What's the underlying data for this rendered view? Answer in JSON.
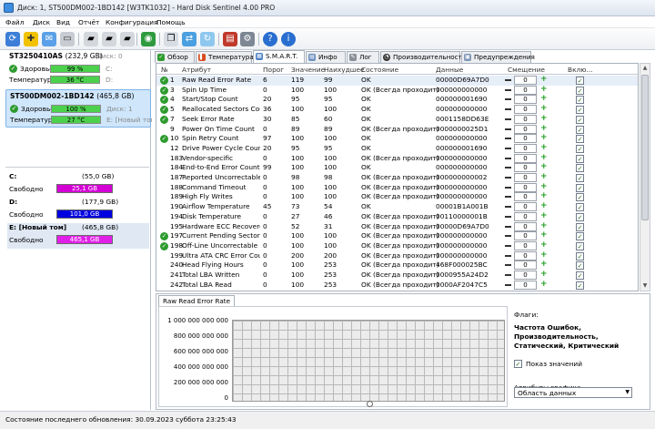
{
  "window": {
    "title": "Диск: 1, ST500DM002-1BD142 [W3TK1032]  -  Hard Disk Sentinel 4.00 PRO"
  },
  "menu": [
    "Файл",
    "Диск",
    "Вид",
    "Отчёт",
    "Конфигурация",
    "Помощь"
  ],
  "toolbar": [
    "refresh-icon",
    "health-icon",
    "mail-icon",
    "disk-icon",
    "drive-a-icon",
    "drive-b-icon",
    "drive-c-icon",
    "globe-icon",
    "copy-icon",
    "transfer-icon",
    "refresh-b-icon",
    "chart-icon",
    "settings-icon",
    "help-icon",
    "info-icon"
  ],
  "disks": [
    {
      "name": "ST3250410AS",
      "size": "(232,9 GB)",
      "disk": "Диск: 0",
      "health_label": "Здоровье:",
      "health": "99 %",
      "health_ext": "C:",
      "temp_label": "Температура:",
      "temp": "36 °C",
      "temp_ext": "D:"
    },
    {
      "name": "ST500DM002-1BD142",
      "size": "(465,8 GB)",
      "disk": "Диск: 1",
      "health_label": "Здоровье:",
      "health": "100 %",
      "health_ext": "Диск: 1",
      "temp_label": "Температура:",
      "temp": "27 °C",
      "temp_ext": "E: [Новый том]"
    }
  ],
  "volumes": [
    {
      "label": "C:",
      "size": "(55,0 GB)",
      "free_label": "Свободно",
      "free": "25,1 GB",
      "color": "#d400d4"
    },
    {
      "label": "D:",
      "size": "(177,9 GB)",
      "free_label": "Свободно",
      "free": "101,0 GB",
      "color": "#0000e0"
    },
    {
      "label": "E: [Новый том]",
      "size": "(465,8 GB)",
      "free_label": "Свободно",
      "free": "465,1 GB",
      "color": "#e020e8"
    }
  ],
  "tabs": [
    "Обзор",
    "Температура",
    "S.M.A.R.T.",
    "Инфо",
    "Лог",
    "Производительность",
    "Предупреждения"
  ],
  "columns": [
    "№",
    "Атрибут",
    "Порог",
    "Значение",
    "Наихудшее",
    "Состояние",
    "Данные",
    "Смещение",
    "Вклю..."
  ],
  "rows": [
    {
      "n": "1",
      "attr": "Raw Read Error Rate",
      "thr": "6",
      "val": "119",
      "worst": "99",
      "state": "OK",
      "data": "00000D69A7D0",
      "off": "0",
      "ok": true
    },
    {
      "n": "3",
      "attr": "Spin Up Time",
      "thr": "0",
      "val": "100",
      "worst": "100",
      "state": "OK (Всегда проходит)",
      "data": "000000000000",
      "off": "0",
      "ok": true
    },
    {
      "n": "4",
      "attr": "Start/Stop Count",
      "thr": "20",
      "val": "95",
      "worst": "95",
      "state": "OK",
      "data": "000000001690",
      "off": "0",
      "ok": true
    },
    {
      "n": "5",
      "attr": "Reallocated Sectors Count",
      "thr": "36",
      "val": "100",
      "worst": "100",
      "state": "OK",
      "data": "000000000000",
      "off": "0",
      "ok": true
    },
    {
      "n": "7",
      "attr": "Seek Error Rate",
      "thr": "30",
      "val": "85",
      "worst": "60",
      "state": "OK",
      "data": "0001158DD63E",
      "off": "0",
      "ok": true
    },
    {
      "n": "9",
      "attr": "Power On Time Count",
      "thr": "0",
      "val": "89",
      "worst": "89",
      "state": "OK (Всегда проходит)",
      "data": "0000000025D1",
      "off": "0",
      "ok": false
    },
    {
      "n": "10",
      "attr": "Spin Retry Count",
      "thr": "97",
      "val": "100",
      "worst": "100",
      "state": "OK",
      "data": "000000000000",
      "off": "0",
      "ok": true
    },
    {
      "n": "12",
      "attr": "Drive Power Cycle Count",
      "thr": "20",
      "val": "95",
      "worst": "95",
      "state": "OK",
      "data": "000000001690",
      "off": "0",
      "ok": false
    },
    {
      "n": "183",
      "attr": "Vendor-specific",
      "thr": "0",
      "val": "100",
      "worst": "100",
      "state": "OK (Всегда проходит)",
      "data": "000000000000",
      "off": "0",
      "ok": false
    },
    {
      "n": "184",
      "attr": "End-to-End Error Count",
      "thr": "99",
      "val": "100",
      "worst": "100",
      "state": "OK",
      "data": "000000000000",
      "off": "0",
      "ok": false
    },
    {
      "n": "187",
      "attr": "Reported Uncorrectable Error...",
      "thr": "0",
      "val": "98",
      "worst": "98",
      "state": "OK (Всегда проходит)",
      "data": "000000000002",
      "off": "0",
      "ok": false
    },
    {
      "n": "188",
      "attr": "Command Timeout",
      "thr": "0",
      "val": "100",
      "worst": "100",
      "state": "OK (Всегда проходит)",
      "data": "000000000000",
      "off": "0",
      "ok": false
    },
    {
      "n": "189",
      "attr": "High Fly Writes",
      "thr": "0",
      "val": "100",
      "worst": "100",
      "state": "OK (Всегда проходит)",
      "data": "000000000000",
      "off": "0",
      "ok": false
    },
    {
      "n": "190",
      "attr": "Airflow Temperature",
      "thr": "45",
      "val": "73",
      "worst": "54",
      "state": "OK",
      "data": "00001B1A001B",
      "off": "0",
      "ok": false
    },
    {
      "n": "194",
      "attr": "Disk Temperature",
      "thr": "0",
      "val": "27",
      "worst": "46",
      "state": "OK (Всегда проходит)",
      "data": "00110000001B",
      "off": "0",
      "ok": false
    },
    {
      "n": "195",
      "attr": "Hardware ECC Recovered",
      "thr": "0",
      "val": "52",
      "worst": "31",
      "state": "OK (Всегда проходит)",
      "data": "00000D69A7D0",
      "off": "0",
      "ok": false
    },
    {
      "n": "197",
      "attr": "Current Pending Sector Co...",
      "thr": "0",
      "val": "100",
      "worst": "100",
      "state": "OK (Всегда проходит)",
      "data": "000000000000",
      "off": "0",
      "ok": true
    },
    {
      "n": "198",
      "attr": "Off-Line Uncorrectable Sec...",
      "thr": "0",
      "val": "100",
      "worst": "100",
      "state": "OK (Всегда проходит)",
      "data": "000000000000",
      "off": "0",
      "ok": true
    },
    {
      "n": "199",
      "attr": "Ultra ATA CRC Error Count",
      "thr": "0",
      "val": "200",
      "worst": "200",
      "state": "OK (Всегда проходит)",
      "data": "000000000000",
      "off": "0",
      "ok": false
    },
    {
      "n": "240",
      "attr": "Head Flying Hours",
      "thr": "0",
      "val": "100",
      "worst": "253",
      "state": "OK (Всегда проходит)",
      "data": "468F000025BC",
      "off": "0",
      "ok": false
    },
    {
      "n": "241",
      "attr": "Total LBA Written",
      "thr": "0",
      "val": "100",
      "worst": "253",
      "state": "OK (Всегда проходит)",
      "data": "0000955A24D2",
      "off": "0",
      "ok": false
    },
    {
      "n": "242",
      "attr": "Total LBA Read",
      "thr": "0",
      "val": "100",
      "worst": "253",
      "state": "OK (Всегда проходит)",
      "data": "0000AF2047C5",
      "off": "0",
      "ok": false
    }
  ],
  "chart": {
    "tab": "Raw Read Error Rate",
    "yticks": [
      "1 000 000 000 000",
      "800 000 000 000",
      "600 000 000 000",
      "400 000 000 000",
      "200 000 000 000",
      "0"
    ]
  },
  "info": {
    "flags_label": "Флаги:",
    "flags": "Частота Ошибок, Производительность, Статический, Критический",
    "show_values": "Показ значений",
    "attr_label": "Атрибуты графика",
    "select": "Область данных"
  },
  "status": "Состояние последнего обновления: 30.09.2023 суббота 23:25:43"
}
